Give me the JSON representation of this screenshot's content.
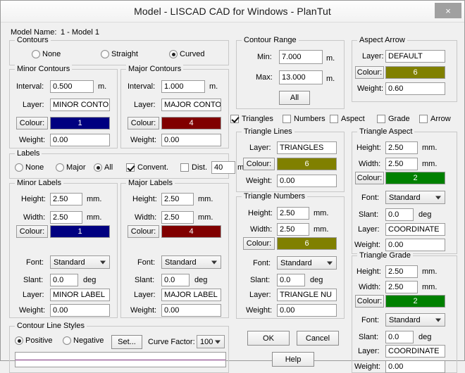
{
  "window": {
    "title": "Model - LISCAD CAD for Windows - PlanTut",
    "close_label": "×"
  },
  "model": {
    "name_label": "Model Name:",
    "name_value": "1 - Model 1"
  },
  "units": {
    "m": "m.",
    "mm": "mm.",
    "deg": "deg"
  },
  "colors": {
    "navy": "#000080",
    "maroon": "#800000",
    "olive": "#808000",
    "green": "#008000",
    "preview_line": "#7b2d7b"
  },
  "contours": {
    "legend": "Contours",
    "options": [
      {
        "label": "None",
        "selected": false
      },
      {
        "label": "Straight",
        "selected": false
      },
      {
        "label": "Curved",
        "selected": true
      }
    ]
  },
  "minor_contours": {
    "legend": "Minor Contours",
    "interval_label": "Interval:",
    "interval_value": "0.500",
    "interval_unit": "m.",
    "layer_label": "Layer:",
    "layer_value": "MINOR CONTOU",
    "colour_label": "Colour:",
    "colour_value": "1",
    "colour_hex": "#000080",
    "weight_label": "Weight:",
    "weight_value": "0.00"
  },
  "major_contours": {
    "legend": "Major Contours",
    "interval_label": "Interval:",
    "interval_value": "1.000",
    "interval_unit": "m.",
    "layer_label": "Layer:",
    "layer_value": "MAJOR CONTOU",
    "colour_label": "Colour:",
    "colour_value": "4",
    "colour_hex": "#800000",
    "weight_label": "Weight:",
    "weight_value": "0.00"
  },
  "labels": {
    "legend": "Labels",
    "options": [
      {
        "label": "None",
        "selected": false
      },
      {
        "label": "Major",
        "selected": false
      },
      {
        "label": "All",
        "selected": true
      }
    ],
    "convent_label": "Convent.",
    "convent_checked": true,
    "dist_label": "Dist.",
    "dist_checked": false,
    "dist_value": "40",
    "dist_unit": "m."
  },
  "minor_labels": {
    "legend": "Minor Labels",
    "height_label": "Height:",
    "height_value": "2.50",
    "height_unit": "mm.",
    "width_label": "Width:",
    "width_value": "2.50",
    "width_unit": "mm.",
    "colour_label": "Colour:",
    "colour_value": "1",
    "colour_hex": "#000080",
    "font_label": "Font:",
    "font_value": "Standard",
    "slant_label": "Slant:",
    "slant_value": "0.0",
    "slant_unit": "deg",
    "layer_label": "Layer:",
    "layer_value": "MINOR LABEL",
    "weight_label": "Weight:",
    "weight_value": "0.00"
  },
  "major_labels": {
    "legend": "Major Labels",
    "height_label": "Height:",
    "height_value": "2.50",
    "height_unit": "mm.",
    "width_label": "Width:",
    "width_value": "2.50",
    "width_unit": "mm.",
    "colour_label": "Colour:",
    "colour_value": "4",
    "colour_hex": "#800000",
    "font_label": "Font:",
    "font_value": "Standard",
    "slant_label": "Slant:",
    "slant_value": "0.0",
    "slant_unit": "deg",
    "layer_label": "Layer:",
    "layer_value": "MAJOR LABEL",
    "weight_label": "Weight:",
    "weight_value": "0.00"
  },
  "contour_line_styles": {
    "legend": "Contour Line Styles",
    "positive_label": "Positive",
    "positive_selected": true,
    "negative_label": "Negative",
    "negative_selected": false,
    "set_button": "Set...",
    "curve_factor_label": "Curve Factor:",
    "curve_factor_value": "100"
  },
  "contour_range": {
    "legend": "Contour Range",
    "min_label": "Min:",
    "min_value": "7.000",
    "min_unit": "m.",
    "max_label": "Max:",
    "max_value": "13.000",
    "max_unit": "m.",
    "all_button": "All"
  },
  "toggles": [
    {
      "label": "Triangles",
      "checked": true
    },
    {
      "label": "Numbers",
      "checked": false
    },
    {
      "label": "Aspect",
      "checked": false
    },
    {
      "label": "Grade",
      "checked": false
    },
    {
      "label": "Arrow",
      "checked": false
    }
  ],
  "triangle_lines": {
    "legend": "Triangle Lines",
    "layer_label": "Layer:",
    "layer_value": "TRIANGLES",
    "colour_label": "Colour:",
    "colour_value": "6",
    "colour_hex": "#808000",
    "weight_label": "Weight:",
    "weight_value": "0.00"
  },
  "triangle_numbers": {
    "legend": "Triangle Numbers",
    "height_label": "Height:",
    "height_value": "2.50",
    "height_unit": "mm.",
    "width_label": "Width:",
    "width_value": "2.50",
    "width_unit": "mm.",
    "colour_label": "Colour:",
    "colour_value": "6",
    "colour_hex": "#808000",
    "font_label": "Font:",
    "font_value": "Standard",
    "slant_label": "Slant:",
    "slant_value": "0.0",
    "slant_unit": "deg",
    "layer_label": "Layer:",
    "layer_value": "TRIANGLE NU",
    "weight_label": "Weight:",
    "weight_value": "0.00"
  },
  "aspect_arrow": {
    "legend": "Aspect Arrow",
    "layer_label": "Layer:",
    "layer_value": "DEFAULT",
    "colour_label": "Colour:",
    "colour_value": "6",
    "colour_hex": "#808000",
    "weight_label": "Weight:",
    "weight_value": "0.60"
  },
  "triangle_aspect": {
    "legend": "Triangle Aspect",
    "height_label": "Height:",
    "height_value": "2.50",
    "height_unit": "mm.",
    "width_label": "Width:",
    "width_value": "2.50",
    "width_unit": "mm.",
    "colour_label": "Colour:",
    "colour_value": "2",
    "colour_hex": "#008000",
    "font_label": "Font:",
    "font_value": "Standard",
    "slant_label": "Slant:",
    "slant_value": "0.0",
    "slant_unit": "deg",
    "layer_label": "Layer:",
    "layer_value": "COORDINATE",
    "weight_label": "Weight:",
    "weight_value": "0.00"
  },
  "triangle_grade": {
    "legend": "Triangle Grade",
    "height_label": "Height:",
    "height_value": "2.50",
    "height_unit": "mm.",
    "width_label": "Width:",
    "width_value": "2.50",
    "width_unit": "mm.",
    "colour_label": "Colour:",
    "colour_value": "2",
    "colour_hex": "#008000",
    "font_label": "Font:",
    "font_value": "Standard",
    "slant_label": "Slant:",
    "slant_value": "0.0",
    "slant_unit": "deg",
    "layer_label": "Layer:",
    "layer_value": "COORDINATE",
    "weight_label": "Weight:",
    "weight_value": "0.00"
  },
  "actions": {
    "ok": "OK",
    "cancel": "Cancel",
    "help": "Help"
  }
}
